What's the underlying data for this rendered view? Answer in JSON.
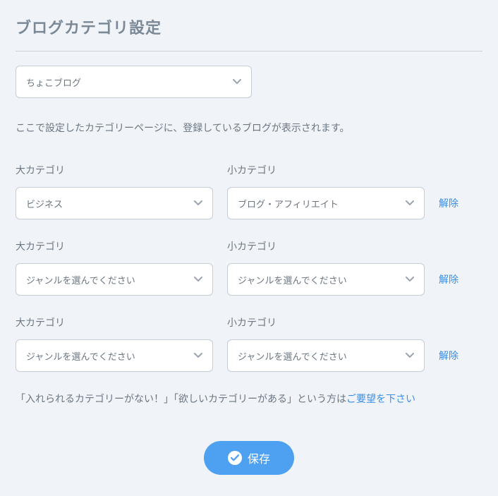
{
  "title": "ブログカテゴリ設定",
  "blog_select": {
    "value": "ちょこブログ"
  },
  "description": "ここで設定したカテゴリーページに、登録しているブログが表示されます。",
  "labels": {
    "big_category": "大カテゴリ",
    "small_category": "小カテゴリ",
    "clear": "解除"
  },
  "rows": [
    {
      "big": "ビジネス",
      "small": "ブログ・アフィリエイト"
    },
    {
      "big": "ジャンルを選んでください",
      "small": "ジャンルを選んでください"
    },
    {
      "big": "ジャンルを選んでください",
      "small": "ジャンルを選んでください"
    }
  ],
  "request": {
    "prefix": "「入れられるカテゴリーがない！」「欲しいカテゴリーがある」という方は",
    "link": "ご要望を下さい"
  },
  "save_label": "保存"
}
